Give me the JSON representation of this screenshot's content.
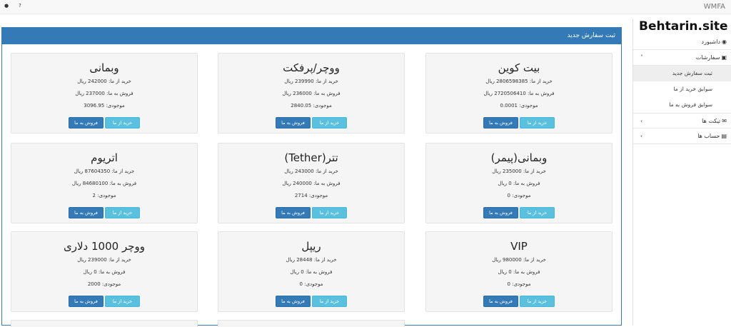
{
  "topbar": {
    "brand": "WMFA",
    "user_icon": "user-icon",
    "help_label": "?"
  },
  "sidebar": {
    "logo": "Behtarin.site",
    "items": [
      {
        "label": "داشبورد",
        "icon": "dashboard-icon"
      },
      {
        "label": "سفارشات",
        "icon": "cart-icon",
        "chevron": "˅"
      },
      {
        "label": "تیکت ها",
        "icon": "envelope-icon",
        "chevron": "›"
      },
      {
        "label": "حساب ها",
        "icon": "money-icon",
        "chevron": "›"
      }
    ],
    "sub_items": [
      {
        "label": "ثبت سفارش جدید"
      },
      {
        "label": "سوابق خرید از ما"
      },
      {
        "label": "سوابق فروش به ما"
      }
    ]
  },
  "panel": {
    "title": "ثبت سفارش جدید"
  },
  "buttons": {
    "buy": "خرید از ما",
    "sell": "فروش به ما"
  },
  "cards": [
    {
      "title": "بیت کوین",
      "buy": "خرید از ما: 2806598385 ریال",
      "sell": "فروش به ما: 2720506410 ریال",
      "stock": "موجودی: 0.0001"
    },
    {
      "title": "ووچر/پرفکت",
      "buy": "خرید از ما: 239990 ریال",
      "sell": "فروش به ما: 236000 ریال",
      "stock": "موجودی: 2840.05"
    },
    {
      "title": "وبمانی",
      "buy": "خرید از ما: 242000 ریال",
      "sell": "فروش به ما: 237000 ریال",
      "stock": "موجودی: 3096.95"
    },
    {
      "title": "وبمانی(پیمر)",
      "buy": "خرید از ما: 235000 ریال",
      "sell": "فروش به ما: 0 ریال",
      "stock": "موجودی: 0"
    },
    {
      "title": "تتر(Tether)",
      "buy": "خرید از ما: 243000 ریال",
      "sell": "فروش به ما: 240000 ریال",
      "stock": "موجودی: 2714"
    },
    {
      "title": "اتریوم",
      "buy": "خرید از ما: 87604350 ریال",
      "sell": "فروش به ما: 84680100 ریال",
      "stock": "موجودی: 2"
    },
    {
      "title": "VIP",
      "buy": "خرید از ما: 980000 ریال",
      "sell": "فروش به ما: 0 ریال",
      "stock": "موجودی: 0"
    },
    {
      "title": "ریپل",
      "buy": "خرید از ما: 28448 ریال",
      "sell": "فروش به ما: 0 ریال",
      "stock": "موجودی: 0"
    },
    {
      "title": "ووچر 1000 دلاری",
      "buy": "خرید از ما: 239000 ریال",
      "sell": "فروش به ما: 0 ریال",
      "stock": "موجودی: 2000"
    }
  ]
}
